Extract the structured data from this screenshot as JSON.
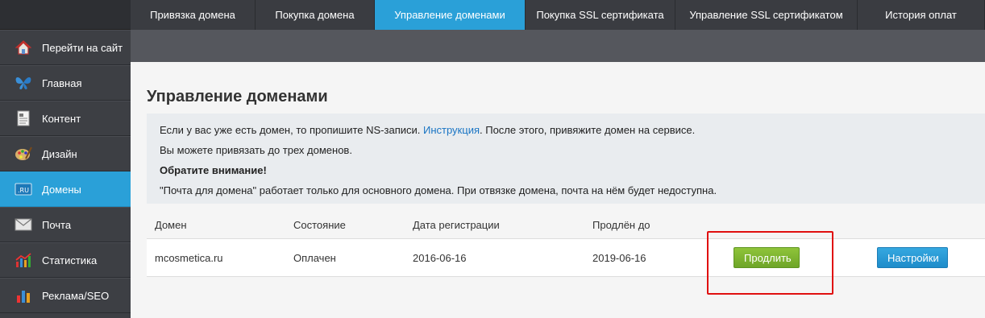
{
  "tabs": [
    {
      "label": "Привязка домена"
    },
    {
      "label": "Покупка домена"
    },
    {
      "label": "Управление доменами"
    },
    {
      "label": "Покупка SSL сертификата"
    },
    {
      "label": "Управление SSL сертификатом"
    },
    {
      "label": "История оплат"
    }
  ],
  "sidebar": {
    "items": [
      {
        "label": "Перейти на сайт",
        "icon": "home-icon"
      },
      {
        "label": "Главная",
        "icon": "butterfly-icon"
      },
      {
        "label": "Контент",
        "icon": "document-icon"
      },
      {
        "label": "Дизайн",
        "icon": "palette-icon"
      },
      {
        "label": "Домены",
        "icon": "ru-domain-icon",
        "icon_text": ".RU"
      },
      {
        "label": "Почта",
        "icon": "mail-icon"
      },
      {
        "label": "Статистика",
        "icon": "chart-icon"
      },
      {
        "label": "Реклама/SEO",
        "icon": "bars-icon"
      }
    ]
  },
  "main": {
    "title": "Управление доменами",
    "info": {
      "line1_before": "Если у вас уже есть домен, то пропишите NS-записи. ",
      "line1_link": "Инструкция",
      "line1_after": ". После этого, привяжите домен на сервисе.",
      "line2": "Вы можете привязать до трех доменов.",
      "line3": "Обратите внимание!",
      "line4": "\"Почта для домена\" работает только для основного домена. При отвязке домена, почта на нём будет недоступна."
    },
    "table": {
      "headers": [
        "Домен",
        "Состояние",
        "Дата регистрации",
        "Продлён до"
      ],
      "row": {
        "domain": "mcosmetica.ru",
        "status": "Оплачен",
        "registered": "2016-06-16",
        "renewed_until": "2019-06-16",
        "renew_label": "Продлить",
        "settings_label": "Настройки"
      }
    }
  },
  "colors": {
    "accent": "#2aa0d8",
    "renew": "#7ab232",
    "highlight": "#e01010"
  }
}
